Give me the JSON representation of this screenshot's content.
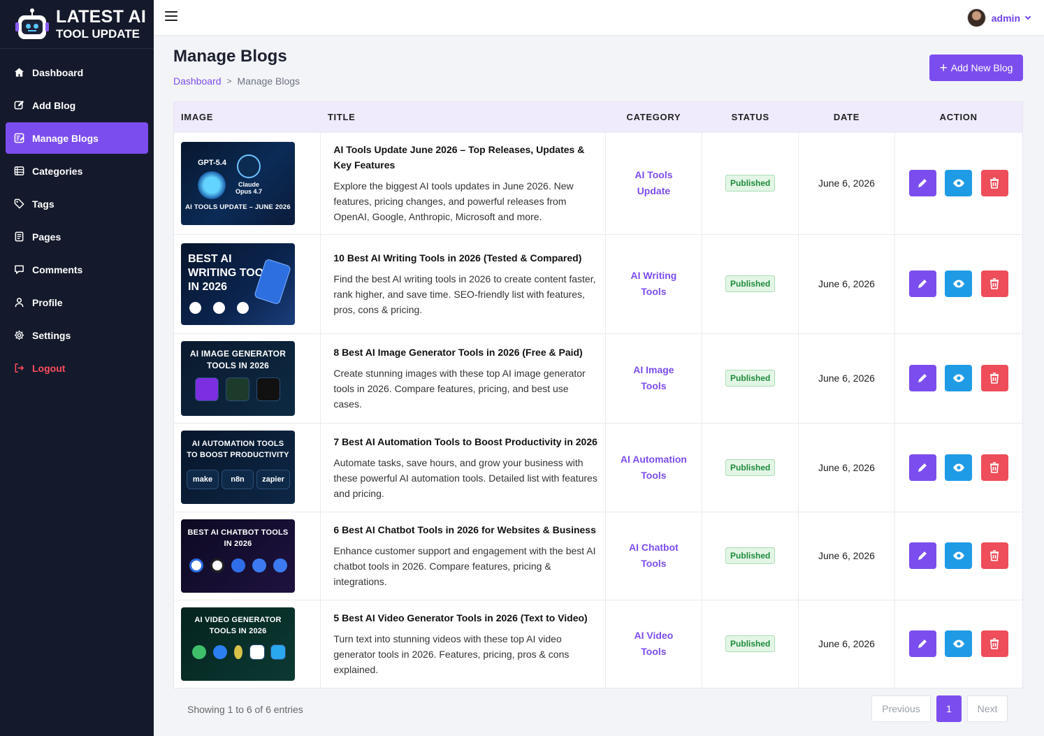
{
  "brand": {
    "line1": "LATEST AI",
    "line2": "TOOL UPDATE"
  },
  "sidebar": {
    "items": [
      {
        "label": "Dashboard",
        "icon": "home-icon"
      },
      {
        "label": "Add Blog",
        "icon": "edit-icon"
      },
      {
        "label": "Manage Blogs",
        "icon": "manage-icon",
        "active": true
      },
      {
        "label": "Categories",
        "icon": "list-icon"
      },
      {
        "label": "Tags",
        "icon": "tag-icon"
      },
      {
        "label": "Pages",
        "icon": "page-icon"
      },
      {
        "label": "Comments",
        "icon": "comment-icon"
      },
      {
        "label": "Profile",
        "icon": "user-icon"
      },
      {
        "label": "Settings",
        "icon": "gear-icon"
      },
      {
        "label": "Logout",
        "icon": "logout-icon"
      }
    ]
  },
  "topbar": {
    "username": "admin"
  },
  "page": {
    "title": "Manage Blogs",
    "breadcrumb": {
      "home": "Dashboard",
      "separator": ">",
      "current": "Manage Blogs"
    },
    "add_button": "Add New Blog"
  },
  "table": {
    "columns": {
      "image": "IMAGE",
      "title": "TITLE",
      "category": "CATEGORY",
      "status": "STATUS",
      "date": "DATE",
      "action": "ACTION"
    },
    "rows": [
      {
        "thumb_text": [
          "GPT-5.4",
          "Claude Opus 4.7",
          "AI TOOLS UPDATE – JUNE 2026"
        ],
        "title": "AI Tools Update June 2026 – Top Releases, Updates & Key Features",
        "description": "Explore the biggest AI tools updates in June 2026. New features, pricing changes, and powerful releases from OpenAI, Google, Anthropic, Microsoft and more.",
        "category": [
          "AI Tools",
          "Update"
        ],
        "status": "Published",
        "date": "June 6, 2026"
      },
      {
        "thumb_text": [
          "BEST AI",
          "WRITING TOOLS",
          "IN 2026"
        ],
        "title": "10 Best AI Writing Tools in 2026 (Tested & Compared)",
        "description": "Find the best AI writing tools in 2026 to create content faster, rank higher, and save time. SEO-friendly list with features, pros, cons & pricing.",
        "category": [
          "AI Writing",
          "Tools"
        ],
        "status": "Published",
        "date": "June 6, 2026"
      },
      {
        "thumb_text": [
          "AI IMAGE GENERATOR",
          "TOOLS IN 2026"
        ],
        "title": "8 Best AI Image Generator Tools in 2026 (Free & Paid)",
        "description": "Create stunning images with these top AI image generator tools in 2026. Compare features, pricing, and best use cases.",
        "category": [
          "AI Image",
          "Tools"
        ],
        "status": "Published",
        "date": "June 6, 2026"
      },
      {
        "thumb_text": [
          "AI AUTOMATION TOOLS",
          "TO BOOST PRODUCTIVITY",
          "make",
          "n8n",
          "zapier"
        ],
        "title": "7 Best AI Automation Tools to Boost Productivity in 2026",
        "description": "Automate tasks, save hours, and grow your business with these powerful AI automation tools. Detailed list with features and pricing.",
        "category": [
          "AI Automation",
          "Tools"
        ],
        "status": "Published",
        "date": "June 6, 2026"
      },
      {
        "thumb_text": [
          "BEST AI CHATBOT TOOLS",
          "IN 2026"
        ],
        "title": "6 Best AI Chatbot Tools in 2026 for Websites & Business",
        "description": "Enhance customer support and engagement with the best AI chatbot tools in 2026. Compare features, pricing & integrations.",
        "category": [
          "AI Chatbot",
          "Tools"
        ],
        "status": "Published",
        "date": "June 6, 2026"
      },
      {
        "thumb_text": [
          "AI VIDEO GENERATOR",
          "TOOLS IN 2026"
        ],
        "title": "5 Best AI Video Generator Tools in 2026 (Text to Video)",
        "description": "Turn text into stunning videos with these top AI video generator tools in 2026. Features, pricing, pros & cons explained.",
        "category": [
          "AI Video",
          "Tools"
        ],
        "status": "Published",
        "date": "June 6, 2026"
      }
    ]
  },
  "footer": {
    "showing": "Showing 1 to 6 of 6 entries",
    "prev": "Previous",
    "current_page": "1",
    "next": "Next"
  },
  "colors": {
    "accent": "#7c4dee",
    "sidebar_bg": "#141a2b",
    "view": "#1f9be6",
    "delete": "#ee4d5a",
    "published": "#1f8a3b"
  }
}
